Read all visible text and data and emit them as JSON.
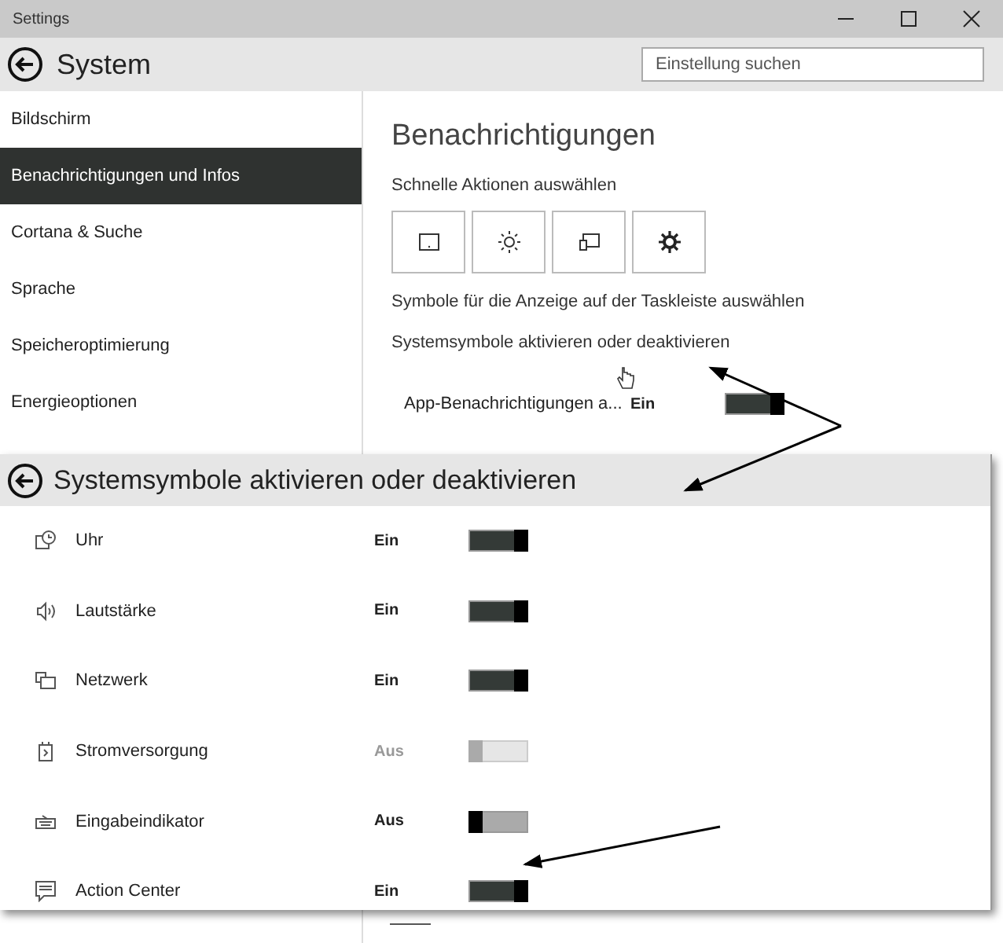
{
  "window": {
    "title": "Settings"
  },
  "header": {
    "title": "System",
    "search": {
      "placeholder": "Einstellung suchen"
    }
  },
  "sidebar": {
    "items": [
      {
        "label": "Bildschirm",
        "selected": false
      },
      {
        "label": "Benachrichtigungen und Infos",
        "selected": true
      },
      {
        "label": "Cortana & Suche",
        "selected": false
      },
      {
        "label": "Sprache",
        "selected": false
      },
      {
        "label": "Speicheroptimierung",
        "selected": false
      },
      {
        "label": "Energieoptionen",
        "selected": false
      }
    ]
  },
  "content": {
    "heading": "Benachrichtigungen",
    "quick_actions_label": "Schnelle Aktionen auswählen",
    "taskbar_link": "Symbole für die Anzeige auf der Taskleiste auswählen",
    "system_icons_link": "Systemsymbole aktivieren oder deaktivieren",
    "setting": {
      "label": "App-Benachrichtigungen a...",
      "state": "Ein",
      "on": true,
      "disabled": false
    }
  },
  "overlay": {
    "title": "Systemsymbole aktivieren oder deaktivieren",
    "rows": [
      {
        "label": "Uhr",
        "state": "Ein",
        "on": true,
        "disabled": false
      },
      {
        "label": "Lautstärke",
        "state": "Ein",
        "on": true,
        "disabled": false
      },
      {
        "label": "Netzwerk",
        "state": "Ein",
        "on": true,
        "disabled": false
      },
      {
        "label": "Stromversorgung",
        "state": "Aus",
        "on": false,
        "disabled": true
      },
      {
        "label": "Eingabeindikator",
        "state": "Aus",
        "on": false,
        "disabled": false
      },
      {
        "label": "Action Center",
        "state": "Ein",
        "on": true,
        "disabled": false
      }
    ]
  }
}
